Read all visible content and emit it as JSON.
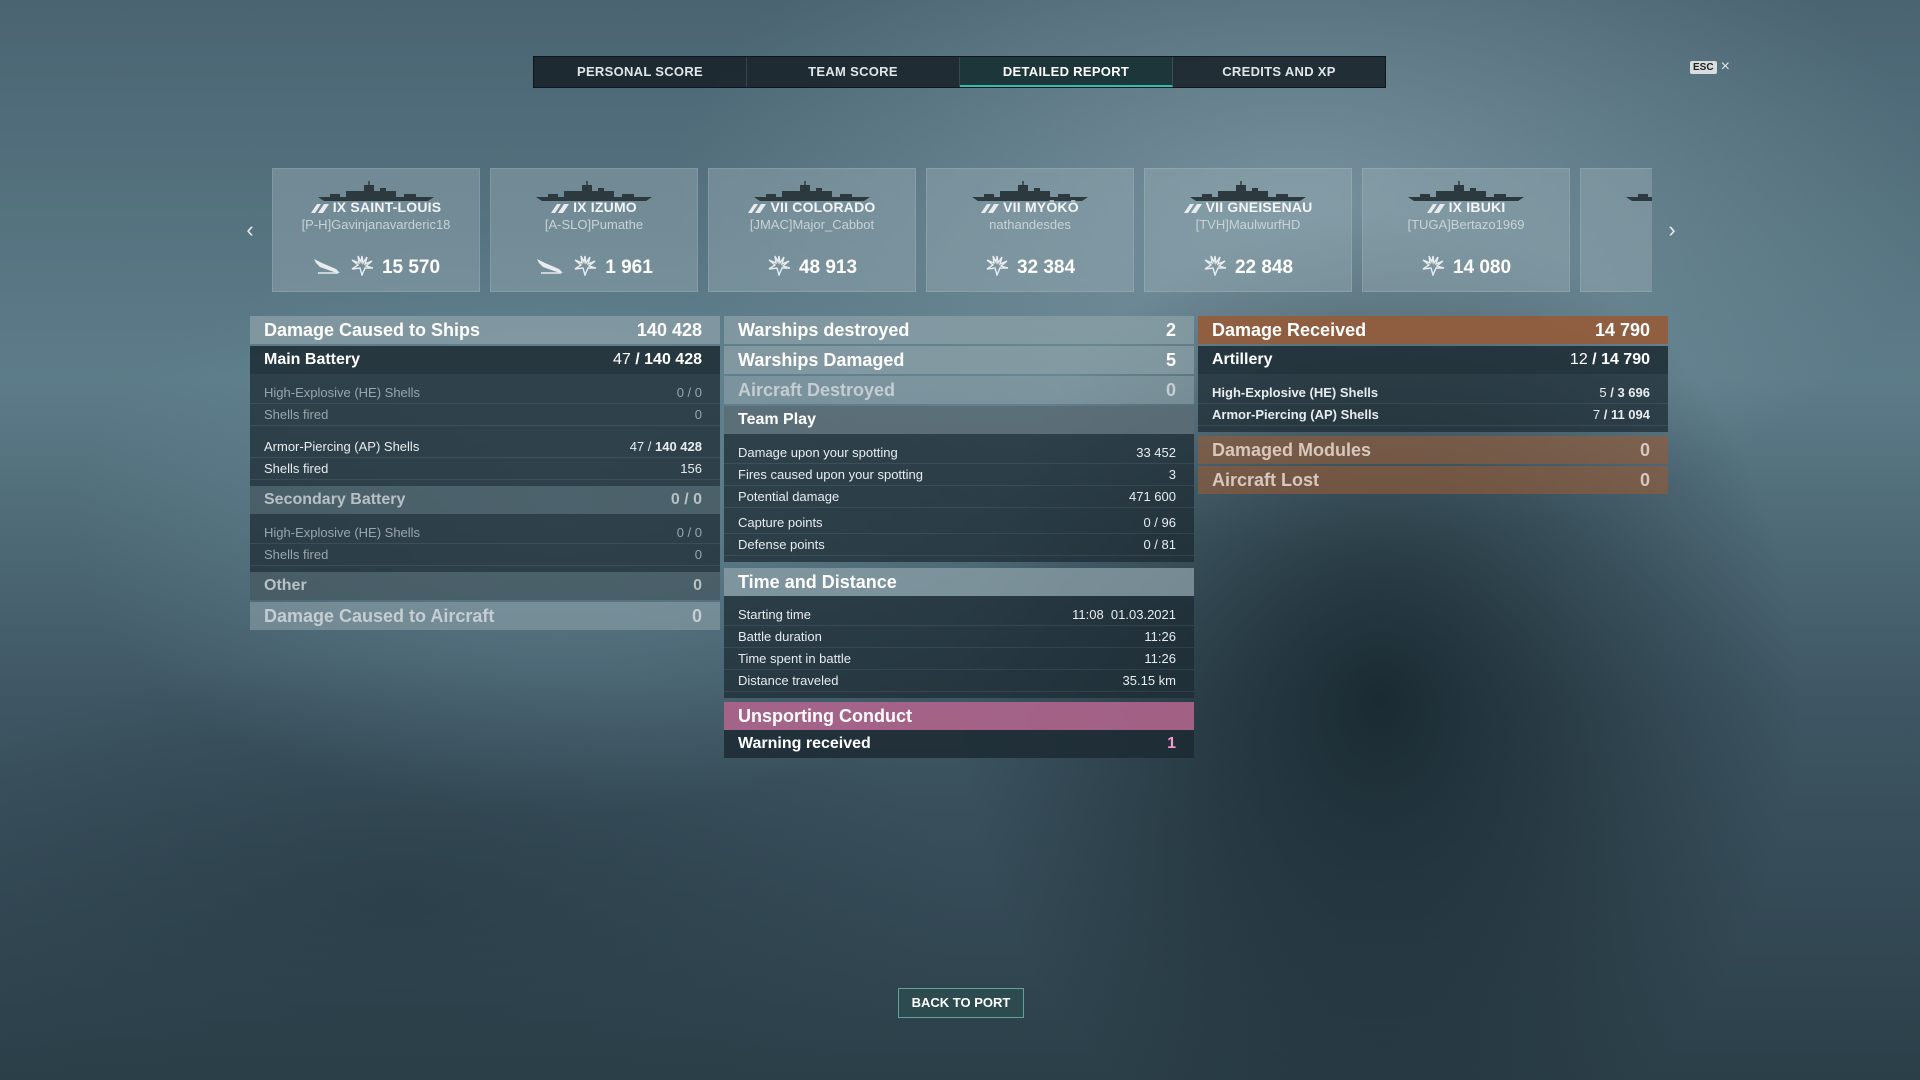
{
  "tabs": [
    {
      "label": "PERSONAL SCORE"
    },
    {
      "label": "TEAM SCORE"
    },
    {
      "label": "DETAILED REPORT"
    },
    {
      "label": "CREDITS AND XP"
    }
  ],
  "esc": {
    "key": "ESC",
    "close": "×"
  },
  "ships": [
    {
      "name": "IX SAINT-LOUIS",
      "player": "[P-H]Gavinjanavarderic18",
      "damage": "15 570",
      "plane": true
    },
    {
      "name": "IX IZUMO",
      "player": "[A-SLO]Pumathe",
      "damage": "1 961",
      "plane": true
    },
    {
      "name": "VII COLORADO",
      "player": "[JMAC]Major_Cabbot",
      "damage": "48 913",
      "plane": false
    },
    {
      "name": "VII MYŌKŌ",
      "player": "nathandesdes",
      "damage": "32 384",
      "plane": false
    },
    {
      "name": "VII GNEISENAU",
      "player": "[TVH]MaulwurfHD",
      "damage": "22 848",
      "plane": false
    },
    {
      "name": "IX IBUKI",
      "player": "[TUGA]Bertazo1969",
      "damage": "14 080",
      "plane": false
    }
  ],
  "left": {
    "damage_ships": {
      "label": "Damage Caused to Ships",
      "value": "140 428"
    },
    "main_battery": {
      "label": "Main Battery",
      "hits": "47",
      "value": "140 428"
    },
    "mb_he": {
      "label": "High-Explosive (HE) Shells",
      "hits": "0",
      "value": "0"
    },
    "mb_he_fired": {
      "label": "Shells fired",
      "value": "0"
    },
    "mb_ap": {
      "label": "Armor-Piercing (AP) Shells",
      "hits": "47",
      "value": "140 428"
    },
    "mb_ap_fired": {
      "label": "Shells fired",
      "value": "156"
    },
    "secondary": {
      "label": "Secondary Battery",
      "hits": "0",
      "value": "0"
    },
    "sec_he": {
      "label": "High-Explosive (HE) Shells",
      "hits": "0",
      "value": "0"
    },
    "sec_he_fired": {
      "label": "Shells fired",
      "value": "0"
    },
    "other": {
      "label": "Other",
      "value": "0"
    },
    "damage_aircraft": {
      "label": "Damage Caused to Aircraft",
      "value": "0"
    }
  },
  "middle": {
    "warships_destroyed": {
      "label": "Warships destroyed",
      "value": "2"
    },
    "warships_damaged": {
      "label": "Warships Damaged",
      "value": "5"
    },
    "aircraft_destroyed": {
      "label": "Aircraft Destroyed",
      "value": "0"
    },
    "team_play": {
      "label": "Team Play"
    },
    "spotting_damage": {
      "label": "Damage upon your spotting",
      "value": "33 452"
    },
    "spotting_fires": {
      "label": "Fires caused upon your spotting",
      "value": "3"
    },
    "potential": {
      "label": "Potential damage",
      "value": "471 600"
    },
    "capture": {
      "label": "Capture points",
      "value": "0 / 96"
    },
    "defense": {
      "label": "Defense points",
      "value": "0 / 81"
    },
    "time_distance": {
      "label": "Time and Distance"
    },
    "start_time": {
      "label": "Starting time",
      "time": "11:08",
      "date": "01.03.2021"
    },
    "duration": {
      "label": "Battle duration",
      "value": "11:26"
    },
    "time_spent": {
      "label": "Time spent in battle",
      "value": "11:26"
    },
    "distance": {
      "label": "Distance traveled",
      "value": "35.15 km"
    },
    "unsporting": {
      "label": "Unsporting Conduct"
    },
    "warning": {
      "label": "Warning received",
      "value": "1"
    }
  },
  "right": {
    "damage_received": {
      "label": "Damage Received",
      "value": "14 790"
    },
    "artillery": {
      "label": "Artillery",
      "hits": "12",
      "value": "14 790"
    },
    "art_he": {
      "label": "High-Explosive (HE) Shells",
      "hits": "5",
      "value": "3 696"
    },
    "art_ap": {
      "label": "Armor-Piercing (AP) Shells",
      "hits": "7",
      "value": "11 094"
    },
    "modules": {
      "label": "Damaged Modules",
      "value": "0"
    },
    "aircraft_lost": {
      "label": "Aircraft Lost",
      "value": "0"
    }
  },
  "back_button": "BACK TO PORT",
  "colors": {
    "accent": "#2fc0b0",
    "received": "#965a37",
    "unsporting": "#af648c",
    "warning_value": "#f39ad0"
  }
}
